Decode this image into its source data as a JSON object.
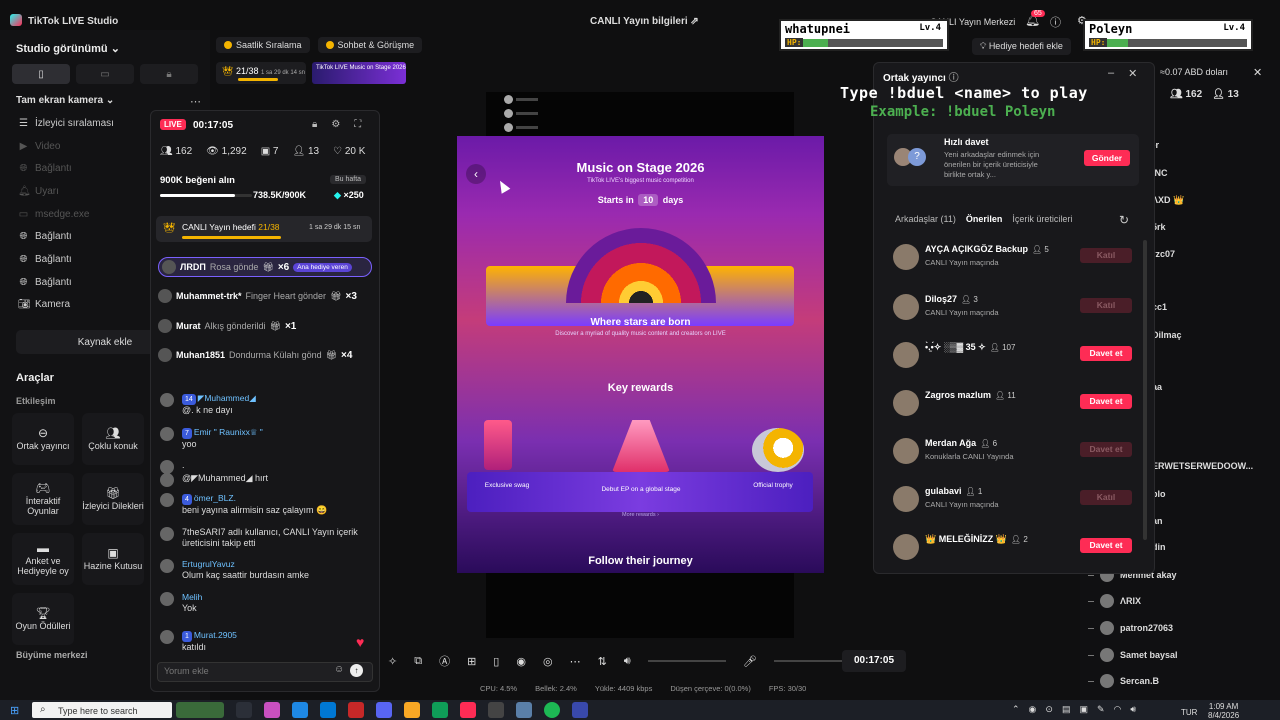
{
  "app": {
    "title": "TikTok LIVE Studio",
    "center_title": "CANLI Yayın bilgileri",
    "live_center": "CANLI Yayın Merkezi",
    "notification_count": "65"
  },
  "left_panel": {
    "studio_view": "Studio görünümü",
    "source_title": "Tam ekran kamera",
    "sources": [
      {
        "label": "İzleyici sıralaması",
        "icon": "list-icon",
        "dim": false
      },
      {
        "label": "Video",
        "icon": "video-icon",
        "dim": true
      },
      {
        "label": "Bağlantı",
        "icon": "globe-icon",
        "dim": true
      },
      {
        "label": "Uyarı",
        "icon": "bell-icon",
        "dim": true
      },
      {
        "label": "msedge.exe",
        "icon": "window-icon",
        "dim": true
      },
      {
        "label": "Bağlantı",
        "icon": "globe-icon",
        "dim": false
      },
      {
        "label": "Bağlantı",
        "icon": "globe-icon",
        "dim": false
      },
      {
        "label": "Bağlantı",
        "icon": "globe-icon",
        "dim": false
      },
      {
        "label": "Kamera",
        "icon": "camera-icon",
        "dim": false
      }
    ],
    "add_source": "Kaynak ekle",
    "tools_title": "Araçlar",
    "tools_sub": "Etkileşim",
    "tools": [
      {
        "label": "Ortak yayıncı",
        "icon": "link-icon"
      },
      {
        "label": "Çoklu konuk",
        "icon": "users-icon"
      },
      {
        "label": "İnteraktif Oyunlar",
        "icon": "gamepad-icon"
      },
      {
        "label": "İzleyici Dilekleri",
        "icon": "gift-icon"
      },
      {
        "label": "Anket ve Hediyeyle oy",
        "icon": "poll-icon"
      },
      {
        "label": "Hazine Kutusu",
        "icon": "chest-icon"
      },
      {
        "label": "Oyun Ödülleri",
        "icon": "trophy-icon"
      }
    ],
    "growth_title": "Büyüme merkezi"
  },
  "pills": {
    "hourly_rank": "Saatlik Sıralama",
    "chat_meet": "Sohbet & Görüşme",
    "rank_value": "21/38",
    "rank_time": "1 sa 29 dk 14 sn",
    "promo_text": "TikTok LIVE Music on Stage 2026"
  },
  "chat": {
    "live_label": "LIVE",
    "timer": "00:17:05",
    "stats": {
      "viewers": "162",
      "views": "1,292",
      "shares": "7",
      "new_followers": "13",
      "likes": "20 K"
    },
    "likes_goal": {
      "title": "900K beğeni alın",
      "week": "Bu hafta",
      "progress": "738.5K/900K",
      "progress_fraction": 0.82,
      "bonus": "×250"
    },
    "live_goal": {
      "label": "CANLI Yayın hedefi",
      "value": "21/38",
      "time": "1 sa 29 dk 15 sn",
      "progress_fraction": 0.55
    },
    "gifts": [
      {
        "user": "ЛRDΠ",
        "gift": "Rosa gönde",
        "count": "×6",
        "tag": "Ana hediye veren",
        "highlight": true
      },
      {
        "user": "Muhammet-trk*",
        "gift": "Finger Heart gönder",
        "count": "×3",
        "tag": "",
        "highlight": false
      },
      {
        "user": "Murat",
        "gift": "Alkış gönderildi",
        "count": "×1",
        "tag": "",
        "highlight": false
      },
      {
        "user": "Muhan1851",
        "gift": "Dondurma Külahı gönd",
        "count": "×4",
        "tag": "",
        "highlight": false
      }
    ],
    "messages": [
      {
        "level": "14",
        "user": "◤Muhammed◢",
        "text": "@. k ne dayı"
      },
      {
        "level": "7",
        "user": "Emir \" Raunixx♕ \"",
        "text": "yoo"
      },
      {
        "level": "",
        "user": "",
        "text": "."
      },
      {
        "level": "",
        "user": "",
        "text": "@◤Muhammed◢ hırt"
      },
      {
        "level": "4",
        "user": "ömer_BLZ.",
        "text": "beni yayına alirmisin saz çalayım 😄"
      },
      {
        "level": "",
        "user": "",
        "text": "7theSARI7 adlı kullanıcı, CANLI Yayın içerik üreticisini takip etti"
      },
      {
        "level": "",
        "user": "ErtugrulYavuz",
        "text": "Olum kaç saattir burdasın amke"
      },
      {
        "level": "",
        "user": "Melih",
        "text": "Yok"
      },
      {
        "level": "1",
        "user": "Murat.2905",
        "text": "katıldı"
      }
    ],
    "comment_placeholder": "Yorum ekle"
  },
  "webpage": {
    "title": "Music on Stage 2026",
    "subtitle": "TikTok LIVE's biggest music competition",
    "starts_in": "Starts in",
    "days_num": "10",
    "days": "days",
    "where": "Where stars are born",
    "discover": "Discover a myriad of quality music content and creators on LIVE",
    "key_rewards": "Key rewards",
    "rewards": [
      "Exclusive swag",
      "Debut EP on a global stage",
      "Official trophy"
    ],
    "more_rewards": "More rewards",
    "follow": "Follow their journey"
  },
  "controls": {
    "timer": "00:17:05",
    "status": {
      "cpu": "CPU: 4.5%",
      "memory": "Bellek: 2.4%",
      "upload": "Yükle: 4409 kbps",
      "dropped": "Düşen çerçeve: 0(0.0%)",
      "fps": "FPS: 30/30"
    }
  },
  "cohost": {
    "title": "Ortak yayıncı",
    "quick_invite_title": "Hızlı davet",
    "quick_invite_desc": "Yeni arkadaşlar edinmek için önerilen bir içerik üreticisiyle birlikte ortak y...",
    "send": "Gönder",
    "tabs": [
      "Arkadaşlar (11)",
      "Önerilen",
      "İçerik üreticileri"
    ],
    "friends": [
      {
        "name": "AYÇA AÇIKGÖZ Backup",
        "count": "5",
        "status": "CANLI Yayın maçında",
        "button": "Katıl",
        "active": false
      },
      {
        "name": "Diloş27",
        "count": "3",
        "status": "CANLI Yayın maçında",
        "button": "Katıl",
        "active": false
      },
      {
        "name": "•̀.̫•́✧ ░▒▓ 35 ✧",
        "count": "107",
        "status": "",
        "button": "Davet et",
        "active": true
      },
      {
        "name": "Zagros mazlum",
        "count": "11",
        "status": "",
        "button": "Davet et",
        "active": true
      },
      {
        "name": "Merdan Ağa",
        "count": "6",
        "status": "Konuklarla CANLI Yayında",
        "button": "Davet et",
        "active": false
      },
      {
        "name": "gulabavi",
        "count": "1",
        "status": "CANLI Yayın maçında",
        "button": "Katıl",
        "active": false
      },
      {
        "name": "👑 MELEĞİNİZZ 👑",
        "count": "2",
        "status": "",
        "button": "Davet et",
        "active": true
      }
    ]
  },
  "overlay": {
    "instruction": "Type !bduel <name> to play",
    "example": "Example: !bduel Poleyn",
    "cards": [
      {
        "name": "whatupnei",
        "level": "Lv.4",
        "hp_label": "HP:",
        "hp_fraction": 0.18
      },
      {
        "name": "Poleyn",
        "level": "Lv.4",
        "hp_label": "HP:",
        "hp_fraction": 0.15
      }
    ]
  },
  "header_right": {
    "gift_goal": "Hediye hedefi ekle",
    "usd": "≈0.07 ABD doları",
    "viewers": "162",
    "followers": "13"
  },
  "right_list": {
    "fragments": [
      "ler",
      "İNC",
      "ΛXD 👑",
      "5rk",
      "rzc07",
      "cc1",
      "Dilmaç",
      "aa",
      "ERWETSERWEDOOW...",
      "blo",
      "an",
      "din"
    ],
    "users": [
      "Mehmet akay",
      "ΛRIX",
      "patron27063",
      "Samet baysal",
      "Sercan.B"
    ]
  },
  "taskbar": {
    "search_placeholder": "Type here to search",
    "language": "TUR",
    "time": "1:09 AM",
    "date": "8/4/2026"
  }
}
